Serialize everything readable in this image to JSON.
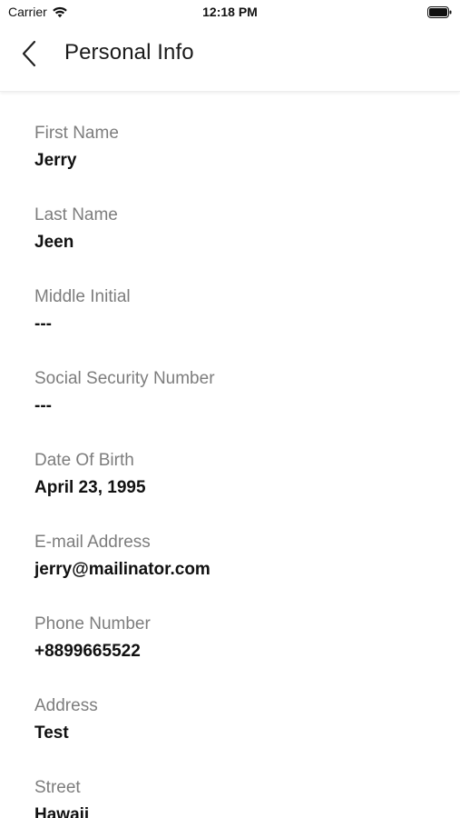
{
  "status_bar": {
    "carrier": "Carrier",
    "time": "12:18 PM",
    "wifi_icon": "wifi-icon",
    "battery_icon": "battery-icon"
  },
  "header": {
    "back_icon": "chevron-left-icon",
    "title": "Personal Info"
  },
  "fields": [
    {
      "label": "First Name",
      "value": "Jerry"
    },
    {
      "label": "Last Name",
      "value": "Jeen"
    },
    {
      "label": "Middle Initial",
      "value": "---"
    },
    {
      "label": "Social Security Number",
      "value": "---"
    },
    {
      "label": "Date Of Birth",
      "value": "April 23, 1995"
    },
    {
      "label": "E-mail Address",
      "value": "jerry@mailinator.com"
    },
    {
      "label": "Phone Number",
      "value": "+8899665522"
    },
    {
      "label": "Address",
      "value": "Test"
    },
    {
      "label": "Street",
      "value": "Hawaii"
    }
  ]
}
